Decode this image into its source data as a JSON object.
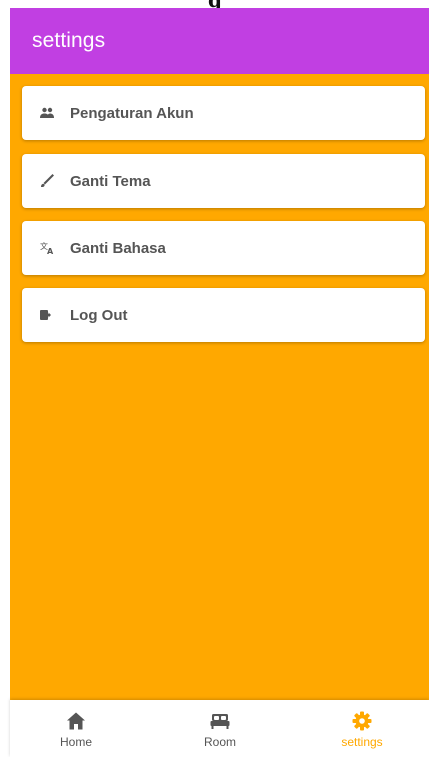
{
  "app_bar": {
    "title": "settings"
  },
  "menu": {
    "items": [
      {
        "label": "Pengaturan Akun",
        "icon": "people-icon"
      },
      {
        "label": "Ganti Tema",
        "icon": "brush-icon"
      },
      {
        "label": "Ganti Bahasa",
        "icon": "translate-icon"
      },
      {
        "label": "Log Out",
        "icon": "logout-icon"
      }
    ]
  },
  "bottom_nav": {
    "items": [
      {
        "label": "Home",
        "icon": "home-icon",
        "active": false
      },
      {
        "label": "Room",
        "icon": "bed-icon",
        "active": false
      },
      {
        "label": "settings",
        "icon": "gear-icon",
        "active": true
      }
    ]
  },
  "colors": {
    "app_bar": "#c13fe2",
    "background": "#ffa800",
    "active_tab": "#ffa800",
    "inactive_text": "#555555"
  }
}
